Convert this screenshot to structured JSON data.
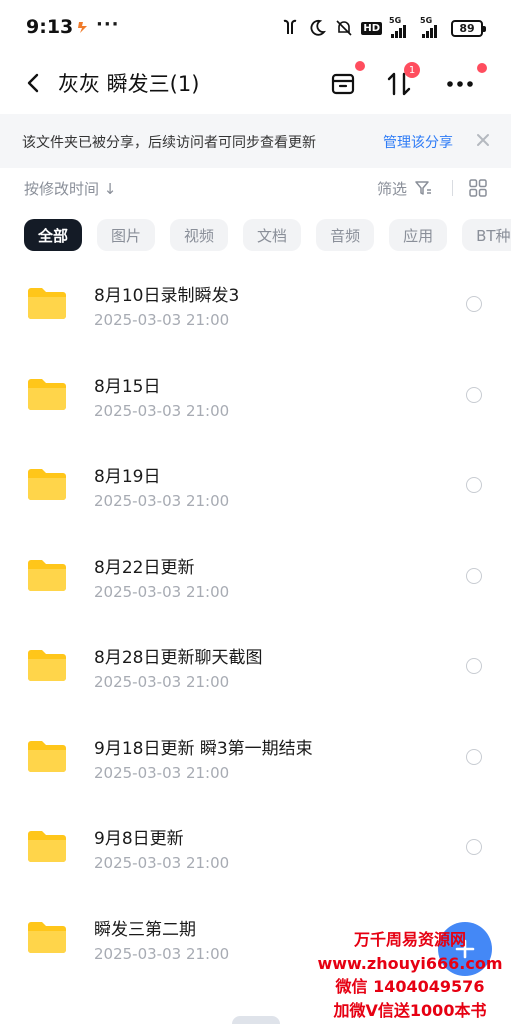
{
  "status_bar": {
    "time": "9:13",
    "more": "···",
    "hd_label": "HD",
    "network_1": "5G",
    "network_2": "5G",
    "battery": "89"
  },
  "header": {
    "back_icon": "chevron-left-icon",
    "title": "灰灰 瞬发三(1)",
    "transfer_badge": "1"
  },
  "share_banner": {
    "text": "该文件夹已被分享，后续访问者可同步查看更新",
    "manage_label": "管理该分享"
  },
  "sort_bar": {
    "sort_label": "按修改时间 ↓",
    "filter_label": "筛选"
  },
  "tabs": [
    {
      "label": "全部",
      "active": true
    },
    {
      "label": "图片"
    },
    {
      "label": "视频"
    },
    {
      "label": "文档"
    },
    {
      "label": "音频"
    },
    {
      "label": "应用"
    },
    {
      "label": "BT种"
    }
  ],
  "files": [
    {
      "name": "8月10日录制瞬发3",
      "date": "2025-03-03  21:00"
    },
    {
      "name": "8月15日",
      "date": "2025-03-03  21:00"
    },
    {
      "name": "8月19日",
      "date": "2025-03-03  21:00"
    },
    {
      "name": "8月22日更新",
      "date": "2025-03-03  21:00"
    },
    {
      "name": "8月28日更新聊天截图",
      "date": "2025-03-03  21:00"
    },
    {
      "name": "9月18日更新 瞬3第一期结束",
      "date": "2025-03-03  21:00"
    },
    {
      "name": "9月8日更新",
      "date": "2025-03-03  21:00"
    },
    {
      "name": "瞬发三第二期",
      "date": "2025-03-03  21:00"
    }
  ],
  "watermark": {
    "line1": "万千周易资源网",
    "line2": "www.zhouyi666.com",
    "line3": "微信 1404049576",
    "line4": "加微V信送1000本书"
  },
  "colors": {
    "accent": "#2f7cf6",
    "tab_active_bg": "#141b26",
    "folder": "#ffc61a",
    "badge": "#ff4d5e",
    "watermark": "#e60012"
  }
}
